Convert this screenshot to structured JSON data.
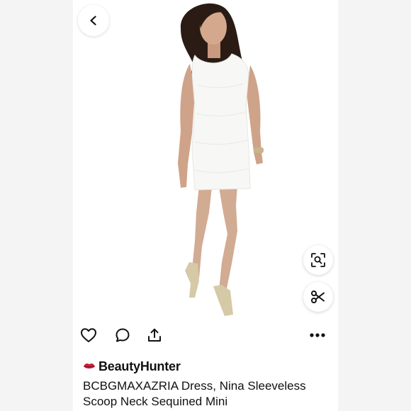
{
  "listing": {
    "seller_name": "BeautyHunter",
    "title": "BCBGMAXAZRIA Dress, Nina Sleeveless Scoop Neck Sequined Mini"
  },
  "icons": {
    "back": "chevron-left-icon",
    "visual_search": "visual-search-icon",
    "cutout": "scissors-icon",
    "like": "heart-icon",
    "comment": "comment-icon",
    "share": "share-icon",
    "more": "more-icon",
    "seller_badge": "lips-icon"
  },
  "colors": {
    "text": "#111111",
    "badge": "#c81e3a",
    "background": "#f4f4f4"
  }
}
